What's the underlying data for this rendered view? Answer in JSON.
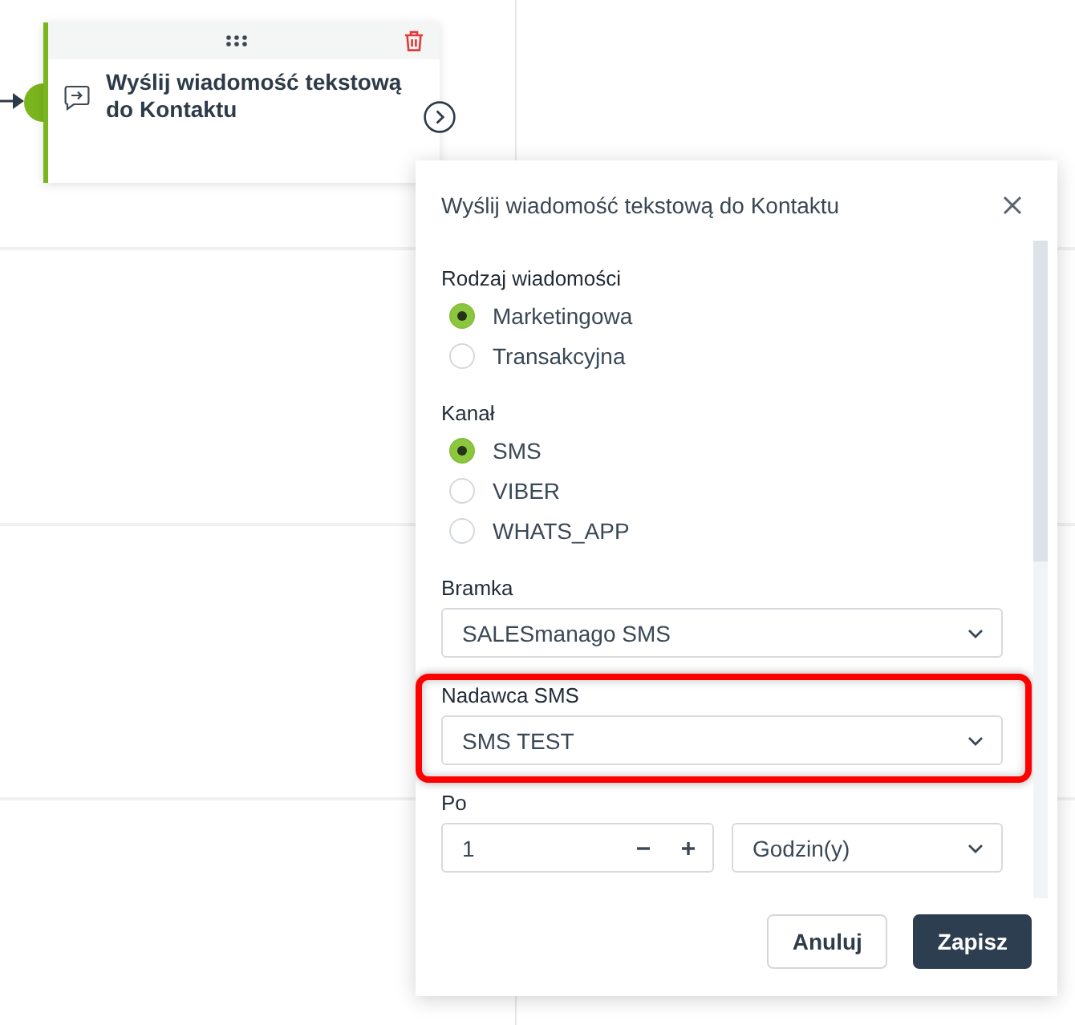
{
  "flow_node": {
    "title": "Wyślij wiadomość tekstową do Kontaktu"
  },
  "panel": {
    "title": "Wyślij wiadomość tekstową do Kontaktu",
    "groups": [
      {
        "label": "Rodzaj wiadomości",
        "options": [
          {
            "label": "Marketingowa",
            "selected": true
          },
          {
            "label": "Transakcyjna",
            "selected": false
          }
        ]
      },
      {
        "label": "Kanał",
        "options": [
          {
            "label": "SMS",
            "selected": true
          },
          {
            "label": "VIBER",
            "selected": false
          },
          {
            "label": "WHATS_APP",
            "selected": false
          }
        ]
      }
    ],
    "fields": [
      {
        "kind": "select",
        "label": "Bramka",
        "value": "SALESmanago SMS",
        "highlighted": false
      },
      {
        "kind": "select",
        "label": "Nadawca SMS",
        "value": "SMS TEST",
        "highlighted": true
      },
      {
        "kind": "delay",
        "label": "Po",
        "value": "1",
        "unit": "Godzin(y)",
        "highlighted": false
      }
    ],
    "buttons": [
      {
        "label": "Anuluj",
        "kind": "secondary"
      },
      {
        "label": "Zapisz",
        "kind": "primary"
      }
    ]
  }
}
